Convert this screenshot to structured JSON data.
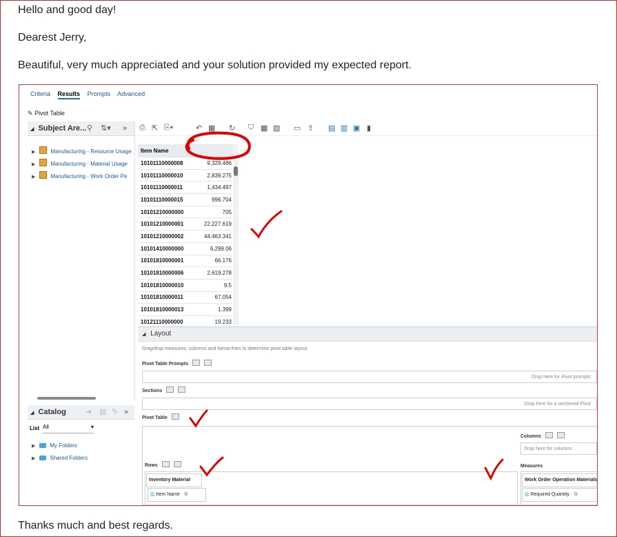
{
  "email": {
    "greeting": "Hello and good day!",
    "salutation": "Dearest Jerry,",
    "body": "Beautiful, very much appreciated and your solution provided my expected report.",
    "closing": "Thanks much and best regards."
  },
  "screenshot": {
    "tabs": [
      "Criteria",
      "Results",
      "Prompts",
      "Advanced"
    ],
    "active_tab": "Results",
    "view_label": "Pivot Table",
    "subject_area": {
      "title": "Subject Are...",
      "items": [
        "Manufacturing - Resource Usage",
        "Manufacturing - Material Usage",
        "Manufacturing - Work Order Pe"
      ]
    },
    "catalog": {
      "title": "Catalog",
      "list_label": "List",
      "list_value": "All",
      "folders": [
        "My Folders",
        "Shared Folders"
      ]
    },
    "table": {
      "column_header": "Item Name",
      "rows": [
        {
          "item": "10101110000008",
          "value": "9,329.486"
        },
        {
          "item": "10101110000010",
          "value": "2,839.275"
        },
        {
          "item": "10101110000011",
          "value": "1,434.497"
        },
        {
          "item": "10101110000015",
          "value": "996.704"
        },
        {
          "item": "10101210000000",
          "value": "705"
        },
        {
          "item": "10101210000001",
          "value": "22,227.619"
        },
        {
          "item": "10101210000002",
          "value": "44,463.341"
        },
        {
          "item": "10101410000000",
          "value": "6,299.06"
        },
        {
          "item": "10101810000001",
          "value": "66.176"
        },
        {
          "item": "10101810000006",
          "value": "2,619.278"
        },
        {
          "item": "10101810000010",
          "value": "9.5"
        },
        {
          "item": "10101810000011",
          "value": "67.054"
        },
        {
          "item": "10101810000013",
          "value": "1.399"
        },
        {
          "item": "10121110000000",
          "value": "19.233"
        }
      ]
    },
    "layout": {
      "title": "Layout",
      "hint": "Drag/drop measures, columns and hierarchies to determine pivot table layout.",
      "pivot_prompts_label": "Pivot Table Prompts",
      "pivot_prompts_drop": "Drop here for Pivot prompts",
      "sections_label": "Sections",
      "sections_drop": "Drop here for a sectioned Pivot",
      "pivot_table_label": "Pivot Table",
      "columns_label": "Columns",
      "columns_drop": "Drop here for columns",
      "rows_label": "Rows",
      "measures_label": "Measures",
      "rows_group": "Inventory Material",
      "rows_item": "Item Name",
      "measures_group": "Work Order Operation Materials",
      "measures_item": "Required Quantity"
    }
  },
  "colors": {
    "frame_border": "#cc2a2a",
    "annotation_red": "#e00000",
    "link_blue": "#1a5a9a"
  }
}
